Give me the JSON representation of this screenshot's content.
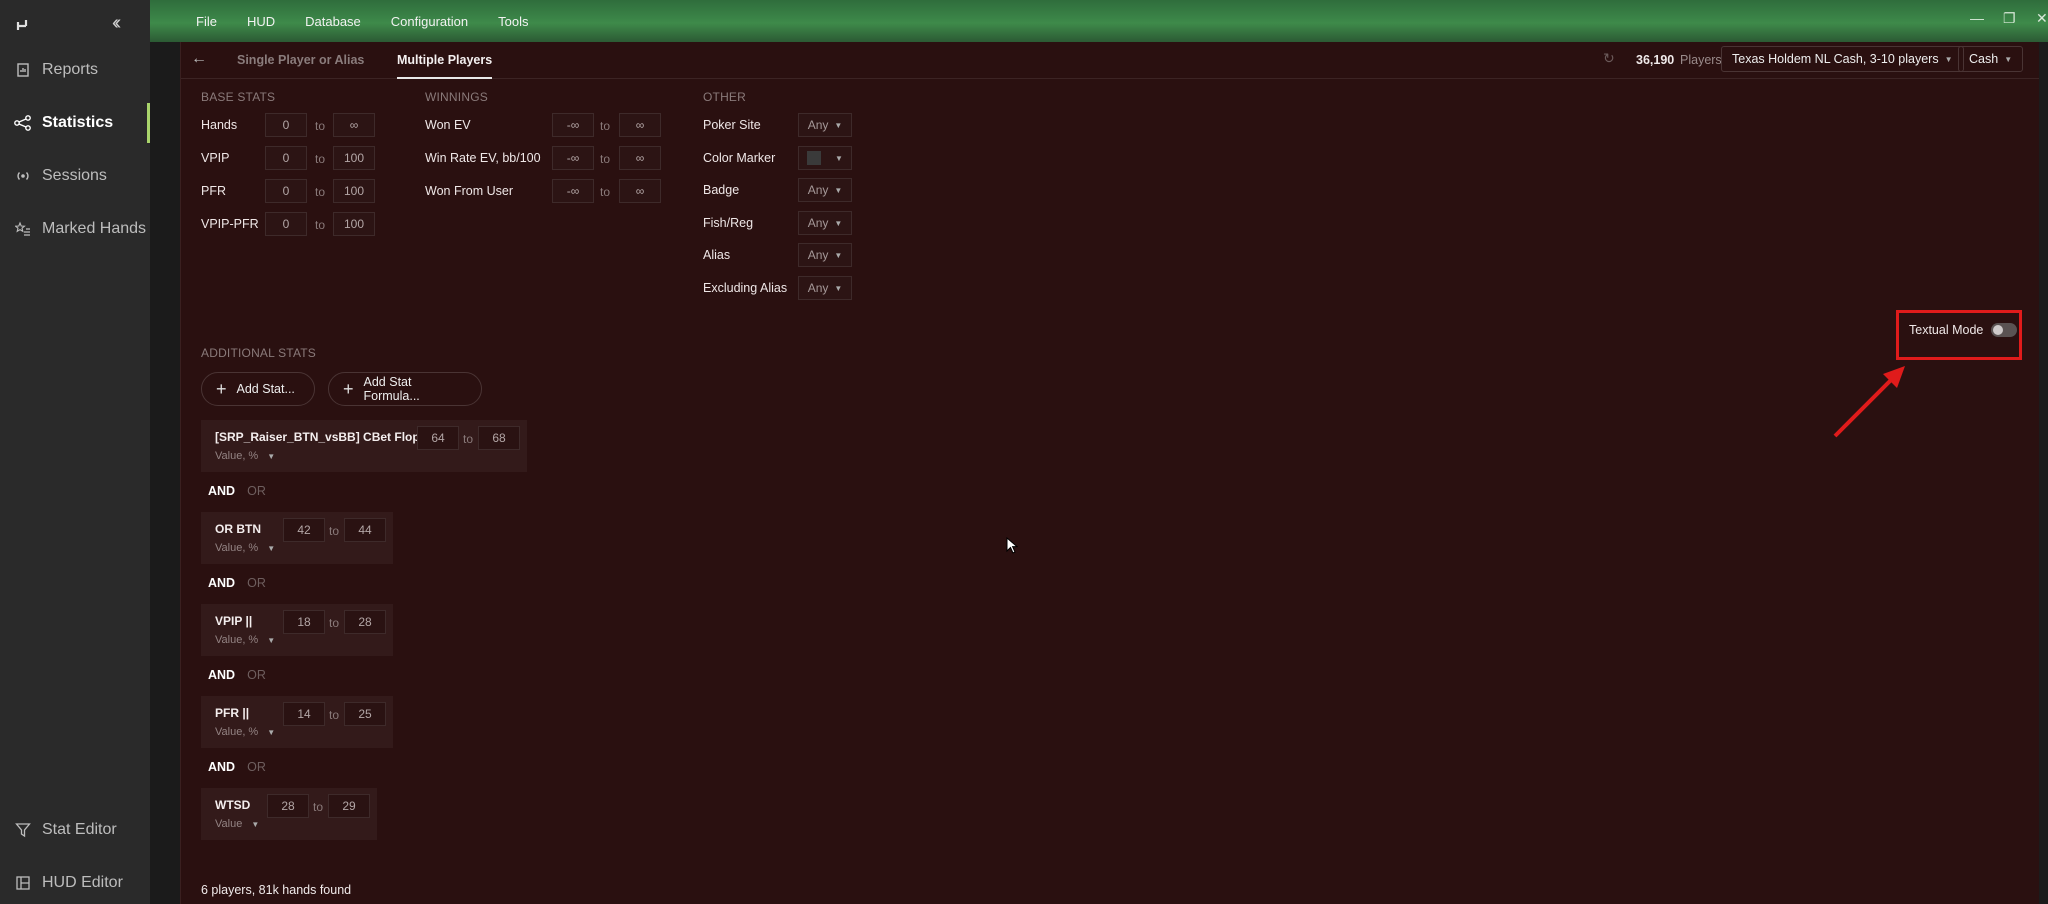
{
  "menu": [
    "File",
    "HUD",
    "Database",
    "Configuration",
    "Tools"
  ],
  "window": {
    "minimize_icon": "minimize-icon",
    "restore_icon": "restore-icon",
    "close_icon": "close-icon"
  },
  "sidebar": {
    "items": [
      {
        "label": "Reports",
        "icon": "report-icon"
      },
      {
        "label": "Statistics",
        "icon": "share-nodes-icon",
        "active": true
      },
      {
        "label": "Sessions",
        "icon": "broadcast-icon"
      },
      {
        "label": "Marked Hands",
        "icon": "star-list-icon"
      }
    ],
    "bottom_items": [
      {
        "label": "Stat Editor",
        "icon": "filter-icon"
      },
      {
        "label": "HUD Editor",
        "icon": "layout-icon"
      }
    ]
  },
  "tabs": [
    "Single Player or Alias",
    "Multiple Players"
  ],
  "header": {
    "player_count": "36,190",
    "player_label": "Players",
    "game_select": "Texas Holdem NL Cash, 3-10 players",
    "type_select": "Cash"
  },
  "base_stats": {
    "title": "BASE STATS",
    "rows": [
      {
        "label": "Hands",
        "min": "0",
        "max": "∞"
      },
      {
        "label": "VPIP",
        "min": "0",
        "max": "100"
      },
      {
        "label": "PFR",
        "min": "0",
        "max": "100"
      },
      {
        "label": "VPIP-PFR",
        "min": "0",
        "max": "100"
      }
    ]
  },
  "winnings": {
    "title": "WINNINGS",
    "rows": [
      {
        "label": "Won EV",
        "min": "-∞",
        "max": "∞"
      },
      {
        "label": "Win Rate EV, bb/100",
        "min": "-∞",
        "max": "∞"
      },
      {
        "label": "Won From User",
        "min": "-∞",
        "max": "∞"
      }
    ]
  },
  "other": {
    "title": "OTHER",
    "rows": [
      {
        "label": "Poker Site",
        "value": "Any"
      },
      {
        "label": "Color Marker",
        "value": ""
      },
      {
        "label": "Badge",
        "value": "Any"
      },
      {
        "label": "Fish/Reg",
        "value": "Any"
      },
      {
        "label": "Alias",
        "value": "Any"
      },
      {
        "label": "Excluding Alias",
        "value": "Any"
      }
    ]
  },
  "to_label": "to",
  "additional": {
    "title": "ADDITIONAL STATS",
    "add_stat": "Add Stat...",
    "add_formula": "Add Stat Formula...",
    "and_label": "AND",
    "or_label": "OR",
    "stats": [
      {
        "name": "[SRP_Raiser_BTN_vsBB] CBet Flop",
        "min": "64",
        "max": "68",
        "unit": "Value, %"
      },
      {
        "name": "OR BTN",
        "min": "42",
        "max": "44",
        "unit": "Value, %"
      },
      {
        "name": "VPIP ||",
        "min": "18",
        "max": "28",
        "unit": "Value, %"
      },
      {
        "name": "PFR ||",
        "min": "14",
        "max": "25",
        "unit": "Value, %"
      },
      {
        "name": "WTSD",
        "min": "28",
        "max": "29",
        "unit": "Value"
      }
    ]
  },
  "textual_mode": {
    "label": "Textual Mode",
    "enabled": false
  },
  "footer": "6 players, 81k hands found",
  "colors": {
    "highlight": "#e01b1b",
    "accent": "#a9d46b",
    "panel_bg": "#2a1010"
  }
}
